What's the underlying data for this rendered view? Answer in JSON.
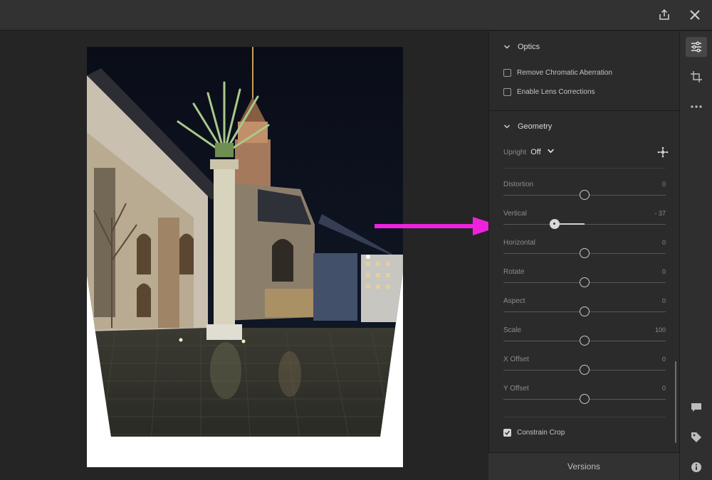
{
  "topbar": {
    "share_icon": "share-icon",
    "close_icon": "close-icon"
  },
  "photo": {
    "subject": "night-church-square"
  },
  "panel": {
    "optics": {
      "title": "Optics",
      "options": [
        {
          "label": "Remove Chromatic Aberration",
          "checked": false
        },
        {
          "label": "Enable Lens Corrections",
          "checked": false
        }
      ]
    },
    "geometry": {
      "title": "Geometry",
      "upright_label": "Upright",
      "upright_value": "Off",
      "sliders": [
        {
          "label": "Distortion",
          "value": "0",
          "fraction": 0.5
        },
        {
          "label": "Vertical",
          "value": "- 37",
          "fraction": 0.315
        },
        {
          "label": "Horizontal",
          "value": "0",
          "fraction": 0.5
        },
        {
          "label": "Rotate",
          "value": "0",
          "fraction": 0.5
        },
        {
          "label": "Aspect",
          "value": "0",
          "fraction": 0.5
        },
        {
          "label": "Scale",
          "value": "100",
          "fraction": 0.5
        },
        {
          "label": "X Offset",
          "value": "0",
          "fraction": 0.5
        },
        {
          "label": "Y Offset",
          "value": "0",
          "fraction": 0.5
        }
      ],
      "constrain_crop_label": "Constrain Crop",
      "constrain_crop_checked": true
    },
    "versions_label": "Versions"
  },
  "annotation": {
    "arrow_color": "#ee22dd"
  },
  "rail": {
    "icons": [
      "sliders-icon",
      "crop-icon",
      "more-icon",
      "comment-icon",
      "tag-icon",
      "info-icon"
    ]
  }
}
